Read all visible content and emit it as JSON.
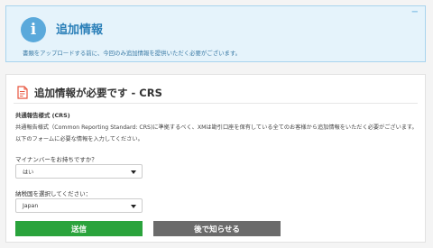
{
  "info": {
    "icon": "info-icon",
    "title": "追加情報",
    "message": "書類をアップロードする前に、今回のみ追加情報を提供いただく必要がございます。",
    "collapse": "−",
    "colors": {
      "accent": "#5aa9db",
      "background": "#e5f3fb"
    }
  },
  "card": {
    "icon": "document-icon",
    "title": "追加情報が必要です - CRS",
    "subheading": "共通報告様式 (CRS)",
    "description1": "共通報告様式（Common Reporting Standard: CRS)に準拠するべく、XMは勘引口座を保有している全てのお客様から追加情報をいただく必要がございます。",
    "description2": "以下のフォームに必要な情報を入力してください。"
  },
  "form": {
    "mynumber_label": "マイナンバーをお持ちですか？",
    "mynumber_value": "はい",
    "country_label": "納税国を選択してください：",
    "country_value": "Japan"
  },
  "buttons": {
    "submit": "送信",
    "later": "後で知らせる",
    "colors": {
      "submit": "#2aa33c",
      "later": "#6b6b6b"
    }
  }
}
